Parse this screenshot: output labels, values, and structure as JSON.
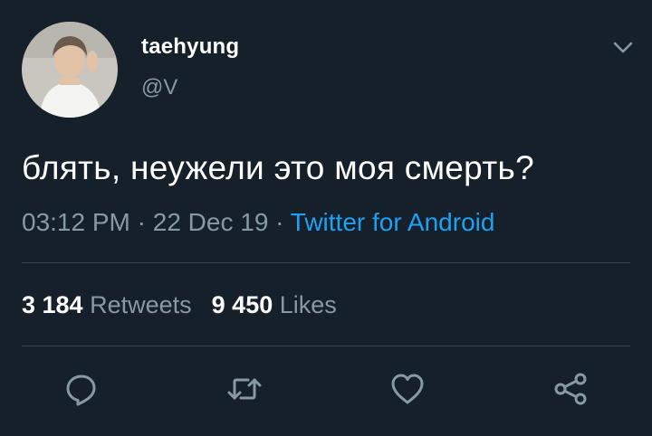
{
  "tweet": {
    "display_name": "taehyung",
    "handle": "@V",
    "text": "блять, неужели это моя смерть?",
    "time": "03:12 PM",
    "separator": " · ",
    "date": "22 Dec 19",
    "source": "Twitter for Android"
  },
  "stats": {
    "retweets_count": "3 184",
    "retweets_label": "Retweets",
    "likes_count": "9 450",
    "likes_label": "Likes"
  },
  "icons": {
    "menu": "chevron-down-icon",
    "reply": "reply-icon",
    "retweet": "retweet-icon",
    "like": "heart-icon",
    "share": "share-icon"
  },
  "colors": {
    "background": "#15202b",
    "text": "#ffffff",
    "secondary": "#8899a6",
    "link": "#1da1f2",
    "divider": "#38444d"
  }
}
